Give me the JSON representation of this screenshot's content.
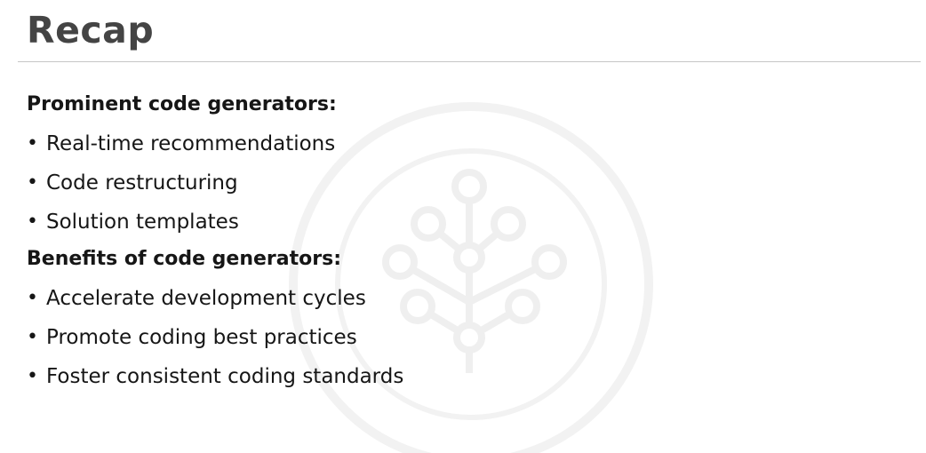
{
  "slide": {
    "title": "Recap",
    "sections": [
      {
        "heading": "Prominent code generators:",
        "items": [
          "Real-time recommendations",
          "Code restructuring",
          "Solution templates"
        ]
      },
      {
        "heading": "Benefits of code generators:",
        "items": [
          "Accelerate development cycles",
          "Promote coding best practices",
          "Foster consistent coding standards"
        ]
      }
    ],
    "bullet_glyph": "•"
  },
  "colors": {
    "title": "#444444",
    "text": "#161616",
    "rule": "#c6c6c6",
    "watermark": "#f2f2f2"
  },
  "icons": {
    "watermark": "network-tree-icon"
  }
}
